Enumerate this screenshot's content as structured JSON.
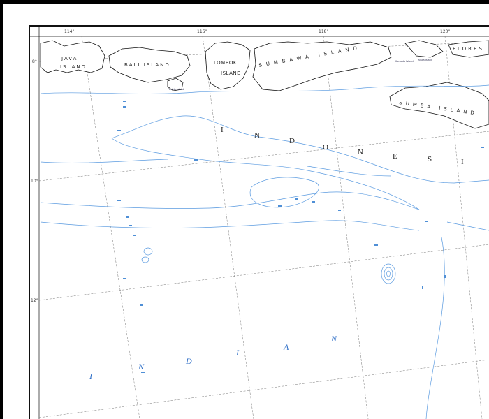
{
  "map": {
    "longitude_labels": [
      "114°",
      "116°",
      "118°",
      "120°"
    ],
    "latitude_labels": [
      "8°",
      "10°",
      "12°"
    ],
    "islands": {
      "java": [
        "JAVA",
        "ISLAND"
      ],
      "bali": "BALI ISLAND",
      "lombok": [
        "LOMBOK",
        "ISLAND"
      ],
      "sumbawa": "SUMBAWA ISLAND",
      "sumba": "SUMBA ISLAND",
      "flores": "FLORES",
      "penida": "Penida Island",
      "komodo": "Komodo Island",
      "rinca": "Rinca Island"
    },
    "country_letters": [
      "I",
      "N",
      "D",
      "O",
      "N",
      "E",
      "S",
      "I"
    ],
    "ocean_letters": [
      "I",
      "N",
      "D",
      "I",
      "A",
      "N"
    ],
    "colors": {
      "land_outline": "#111111",
      "water_contour": "#5b9be0",
      "grid": "#777777",
      "ocean_label": "#2f6fc7"
    }
  }
}
